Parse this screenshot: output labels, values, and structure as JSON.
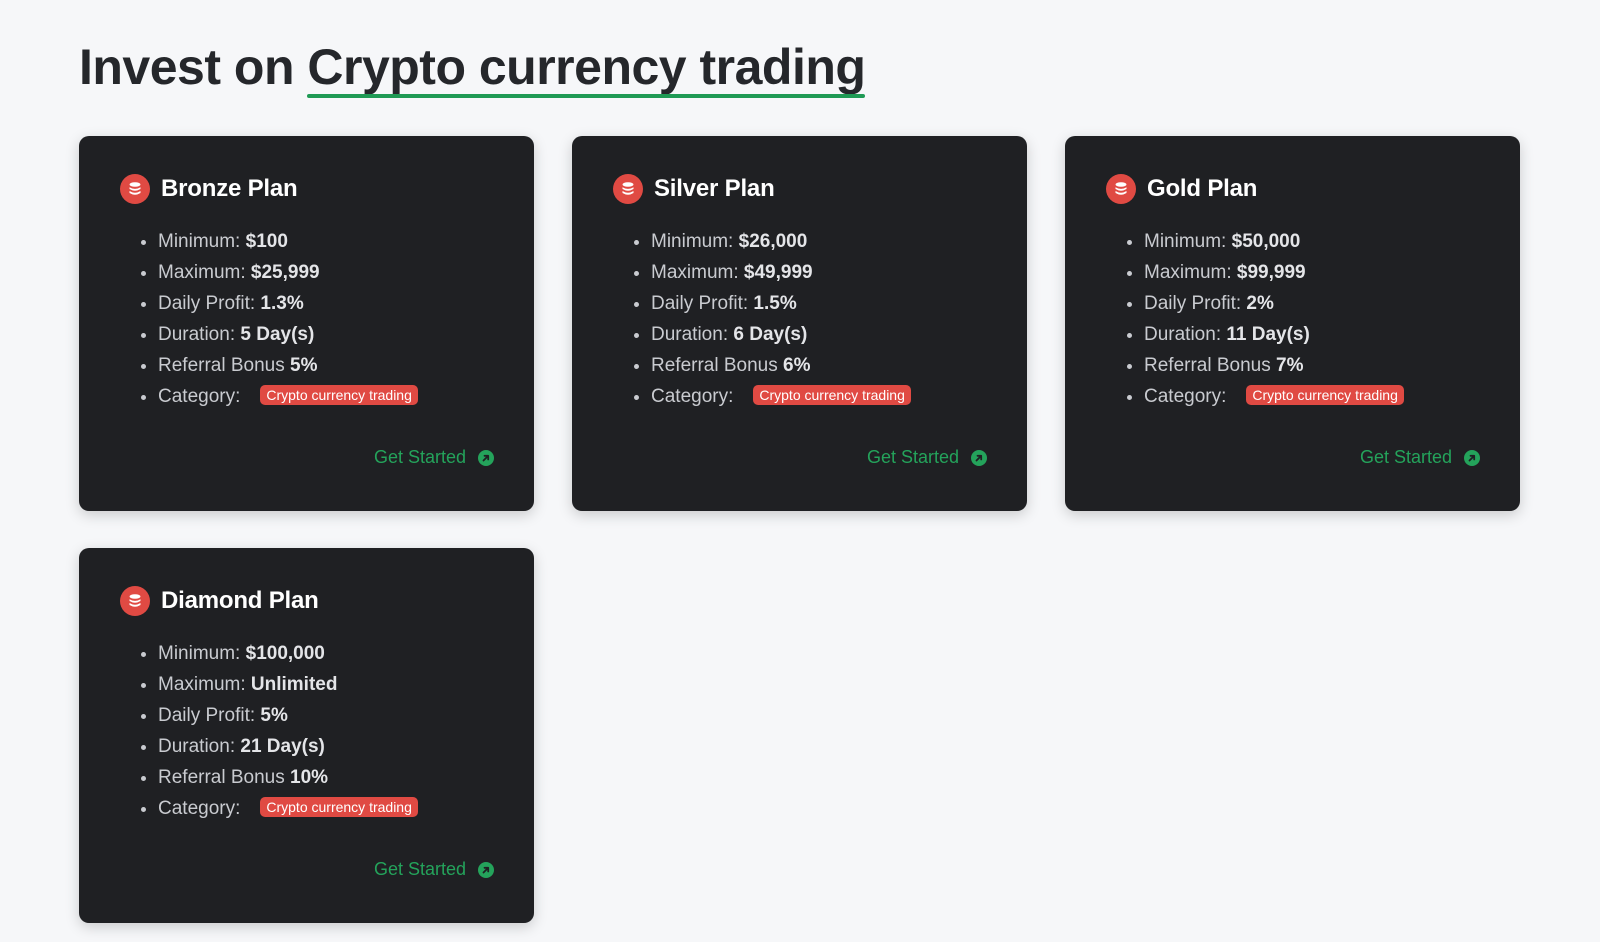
{
  "heading": {
    "prefix": "Invest on ",
    "highlight": "Crypto currency trading"
  },
  "labels": {
    "minimum": "Minimum:",
    "maximum": "Maximum:",
    "daily_profit": "Daily Profit:",
    "duration": "Duration:",
    "referral_bonus": "Referral Bonus",
    "category": "Category:",
    "cta": "Get Started"
  },
  "colors": {
    "accent_green": "#24a35b",
    "accent_red": "#e04a43",
    "card_bg": "#1f2023",
    "page_bg": "#f6f7f9"
  },
  "icons": {
    "plan": "coins-icon",
    "cta": "arrow-up-right-circle-icon"
  },
  "plans": [
    {
      "title": "Bronze Plan",
      "minimum": "$100",
      "maximum": "$25,999",
      "daily_profit": "1.3%",
      "duration": "5 Day(s)",
      "referral_bonus": "5%",
      "category": "Crypto currency trading"
    },
    {
      "title": "Silver Plan",
      "minimum": "$26,000",
      "maximum": "$49,999",
      "daily_profit": "1.5%",
      "duration": "6 Day(s)",
      "referral_bonus": "6%",
      "category": "Crypto currency trading"
    },
    {
      "title": "Gold Plan",
      "minimum": "$50,000",
      "maximum": "$99,999",
      "daily_profit": "2%",
      "duration": "11 Day(s)",
      "referral_bonus": "7%",
      "category": "Crypto currency trading"
    },
    {
      "title": "Diamond Plan",
      "minimum": "$100,000",
      "maximum": "Unlimited",
      "daily_profit": "5%",
      "duration": "21 Day(s)",
      "referral_bonus": "10%",
      "category": "Crypto currency trading"
    }
  ]
}
